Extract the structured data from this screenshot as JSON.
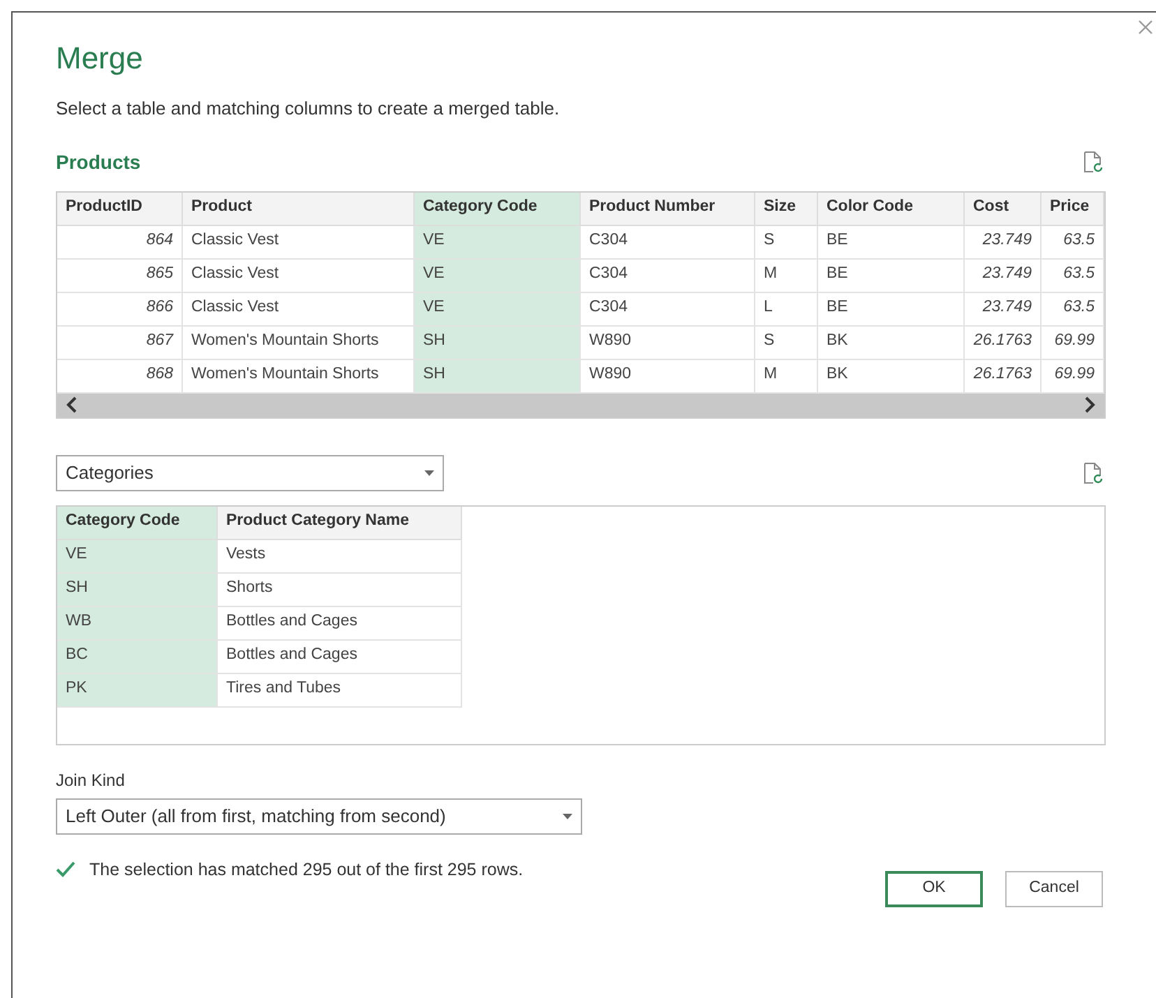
{
  "dialog": {
    "title": "Merge",
    "subtitle": "Select a table and matching columns to create a merged table."
  },
  "first_table": {
    "name": "Products",
    "columns": [
      {
        "label": "ProductID",
        "selected": false,
        "kind": "number"
      },
      {
        "label": "Product",
        "selected": false,
        "kind": "text"
      },
      {
        "label": "Category Code",
        "selected": true,
        "kind": "text"
      },
      {
        "label": "Product Number",
        "selected": false,
        "kind": "text"
      },
      {
        "label": "Size",
        "selected": false,
        "kind": "text"
      },
      {
        "label": "Color Code",
        "selected": false,
        "kind": "text"
      },
      {
        "label": "Cost",
        "selected": false,
        "kind": "number"
      },
      {
        "label": "Price",
        "selected": false,
        "kind": "number"
      }
    ],
    "rows": [
      [
        "864",
        "Classic Vest",
        "VE",
        "C304",
        "S",
        "BE",
        "23.749",
        "63.5"
      ],
      [
        "865",
        "Classic Vest",
        "VE",
        "C304",
        "M",
        "BE",
        "23.749",
        "63.5"
      ],
      [
        "866",
        "Classic Vest",
        "VE",
        "C304",
        "L",
        "BE",
        "23.749",
        "63.5"
      ],
      [
        "867",
        "Women's Mountain Shorts",
        "SH",
        "W890",
        "S",
        "BK",
        "26.1763",
        "69.99"
      ],
      [
        "868",
        "Women's Mountain Shorts",
        "SH",
        "W890",
        "M",
        "BK",
        "26.1763",
        "69.99"
      ]
    ]
  },
  "second_table": {
    "dropdown": "Categories",
    "columns": [
      {
        "label": "Category Code",
        "selected": true
      },
      {
        "label": "Product Category Name",
        "selected": false
      }
    ],
    "rows": [
      [
        "VE",
        "Vests"
      ],
      [
        "SH",
        "Shorts"
      ],
      [
        "WB",
        "Bottles and Cages"
      ],
      [
        "BC",
        "Bottles and Cages"
      ],
      [
        "PK",
        "Tires and Tubes"
      ]
    ]
  },
  "join_kind": {
    "label": "Join Kind",
    "value": "Left Outer (all from first, matching from second)"
  },
  "status": "The selection has matched 295 out of the first 295 rows.",
  "buttons": [
    {
      "label": "OK",
      "kind": "primary"
    },
    {
      "label": "Cancel",
      "kind": "secondary"
    }
  ]
}
